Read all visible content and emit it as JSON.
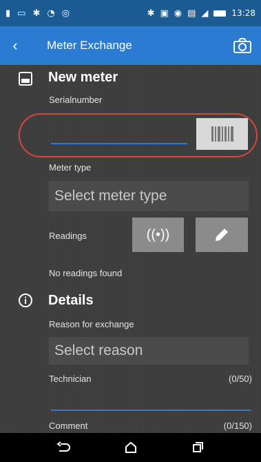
{
  "statusbar": {
    "time": "13:28",
    "left_icons": [
      "person-icon",
      "cast-icon",
      "bluetooth-icon",
      "wifi-icon",
      "android-icon"
    ],
    "right_icons": [
      "bluetooth-icon",
      "nfc-icon",
      "vibrate-icon",
      "battery-icon",
      "signal-icon"
    ]
  },
  "appbar": {
    "title": "Meter Exchange",
    "back_label": "‹"
  },
  "new_meter": {
    "title": "New meter",
    "serial_label": "Serialnumber",
    "meter_type_label": "Meter type",
    "meter_type_placeholder": "Select meter type",
    "readings_label": "Readings",
    "no_readings": "No readings found"
  },
  "details": {
    "title": "Details",
    "reason_label": "Reason for exchange",
    "reason_placeholder": "Select reason",
    "technician_label": "Technician",
    "technician_counter": "(0/50)",
    "comment_label": "Comment",
    "comment_counter": "(0/150)"
  },
  "colors": {
    "statusbar": "#1b5a93",
    "appbar": "#2a7bd1",
    "accent_line": "#2f79d2",
    "highlight": "#d7473d"
  }
}
